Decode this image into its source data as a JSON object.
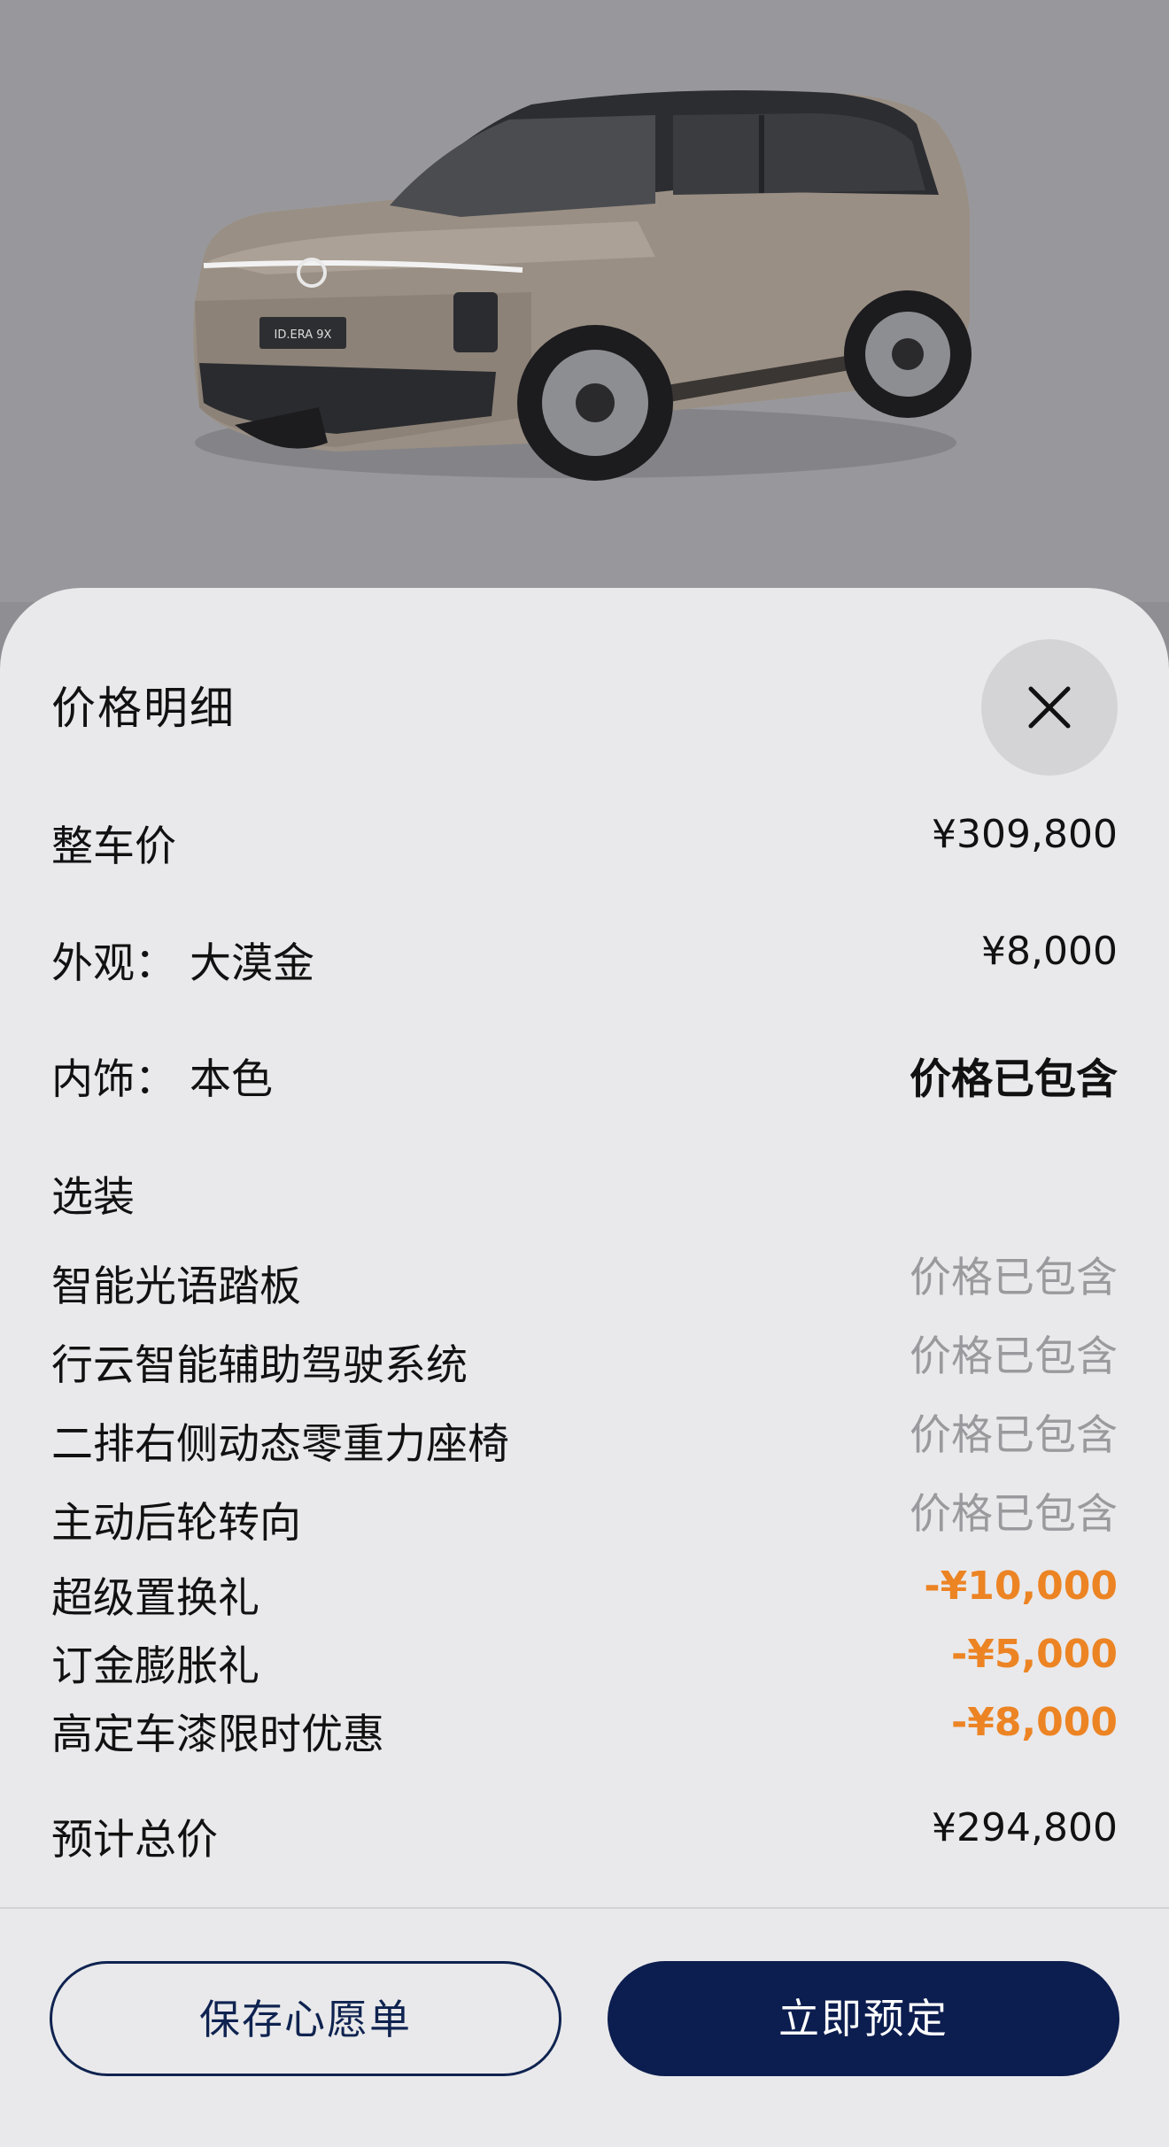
{
  "hero": {
    "image": "car-suv-image",
    "plate_text": "ID.ERA 9X"
  },
  "panel": {
    "title": "价格明细",
    "close_icon": "close-icon"
  },
  "rows": {
    "vehicle_price": {
      "label": "整车价",
      "value": "¥309,800"
    },
    "exterior": {
      "label": "外观：  大漠金",
      "value": "¥8,000"
    },
    "interior": {
      "label": "内饰：  本色",
      "value": "价格已包含"
    },
    "options_header": {
      "label": "选装"
    },
    "option_1": {
      "label": "智能光语踏板",
      "value": "价格已包含"
    },
    "option_2": {
      "label": "行云智能辅助驾驶系统",
      "value": "价格已包含"
    },
    "option_3": {
      "label": "二排右侧动态零重力座椅",
      "value": "价格已包含"
    },
    "option_4": {
      "label": "主动后轮转向",
      "value": "价格已包含"
    },
    "discount_1": {
      "label": "超级置换礼",
      "value": "-¥10,000"
    },
    "discount_2": {
      "label": "订金膨胀礼",
      "value": "-¥5,000"
    },
    "discount_3": {
      "label": "高定车漆限时优惠",
      "value": "-¥8,000"
    },
    "total": {
      "label": "预计总价",
      "value": "¥294,800"
    }
  },
  "actions": {
    "save_wishlist": "保存心愿单",
    "reserve_now": "立即预定"
  },
  "colors": {
    "discount": "#ec8424",
    "primary": "#0c1d4f",
    "muted": "#9a9a9e"
  }
}
